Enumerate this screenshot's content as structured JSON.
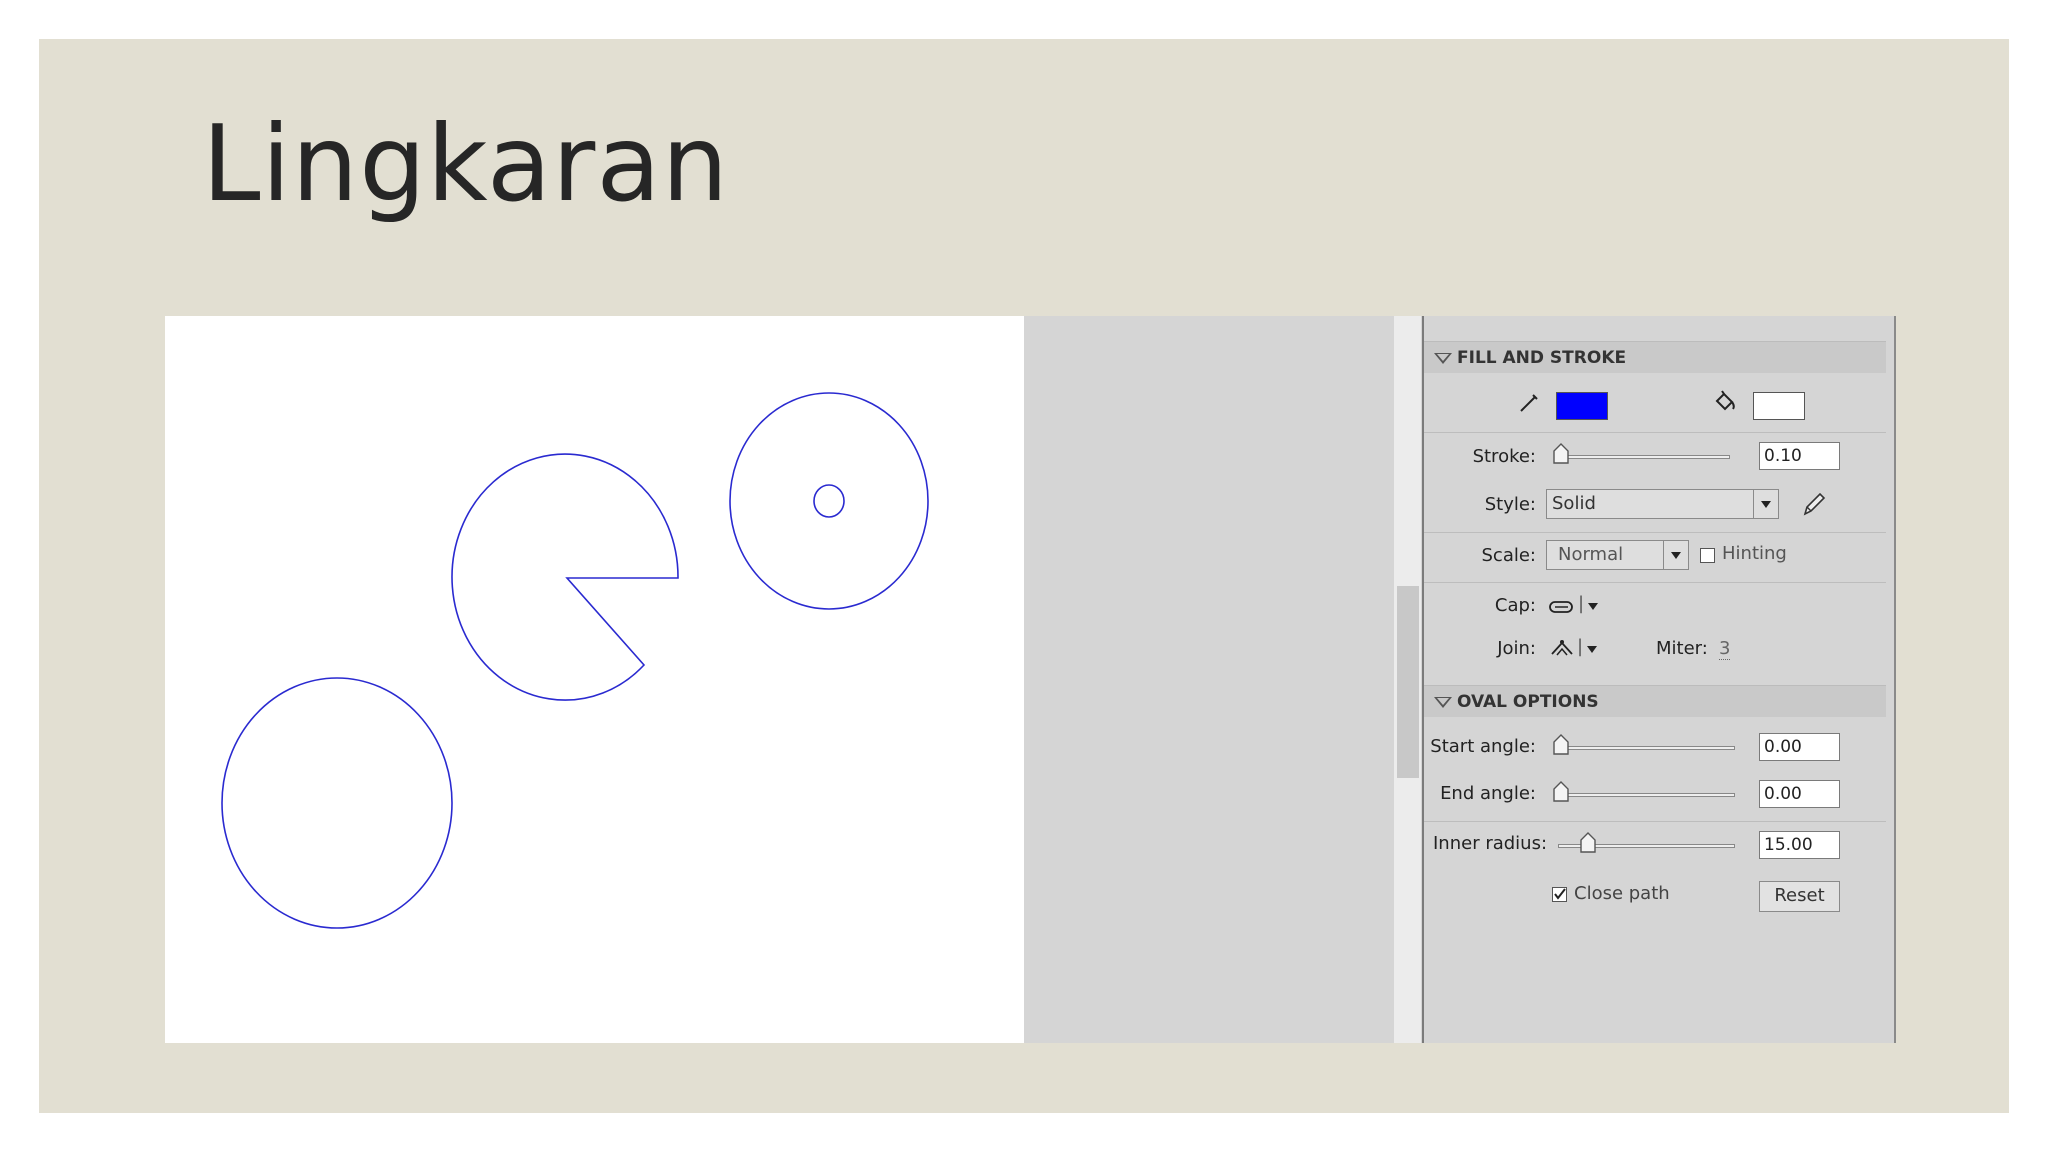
{
  "slide": {
    "title": "Lingkaran"
  },
  "colors": {
    "slide_bg": "#e2dfd2",
    "stroke_color": "#0000ff",
    "fill_color": "#ffffff",
    "shape_stroke": "#2a2ad0"
  },
  "panel": {
    "fill_and_stroke": {
      "header": "FILL AND STROKE",
      "stroke_icon": "pencil-icon",
      "fill_icon": "paint-bucket-icon",
      "stroke_label": "Stroke:",
      "stroke_value": "0.10",
      "style_label": "Style:",
      "style_value": "Solid",
      "style_edit_icon": "pencil-edit-icon",
      "scale_label": "Scale:",
      "scale_value": "Normal",
      "hinting_label": "Hinting",
      "hinting_checked": false,
      "cap_label": "Cap:",
      "cap_icon": "cap-round-icon",
      "join_label": "Join:",
      "join_icon": "join-round-icon",
      "miter_label": "Miter:",
      "miter_value": "3"
    },
    "oval_options": {
      "header": "OVAL OPTIONS",
      "start_angle_label": "Start angle:",
      "start_angle_value": "0.00",
      "end_angle_label": "End angle:",
      "end_angle_value": "0.00",
      "inner_radius_label": "Inner radius:",
      "inner_radius_value": "15.00",
      "close_path_label": "Close path",
      "close_path_checked": true,
      "reset_label": "Reset"
    }
  }
}
